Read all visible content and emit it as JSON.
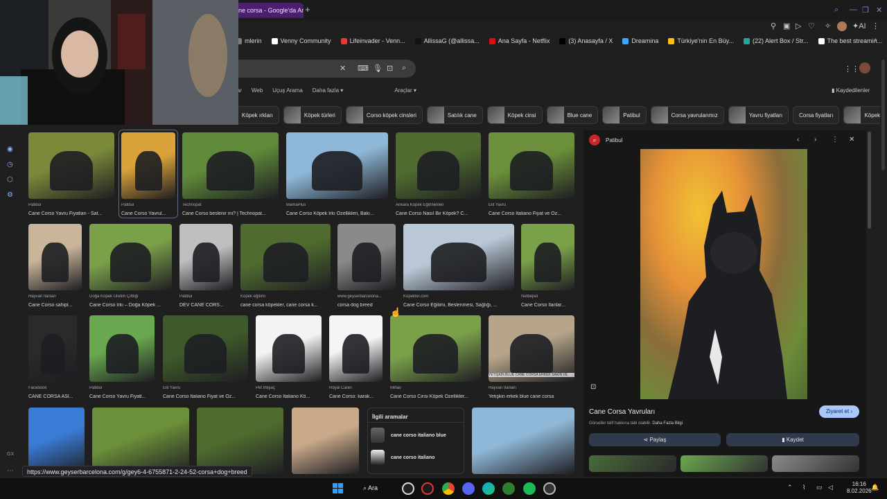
{
  "tab": {
    "title": "ne corsa - Google'da Ar"
  },
  "bookmarks": [
    {
      "label": "mlerin",
      "color": "#7a7a7a"
    },
    {
      "label": "Venny Community",
      "color": "#ffffff"
    },
    {
      "label": "Lifeinvader - Venn...",
      "color": "#e53935"
    },
    {
      "label": "AllissaG (@allissa...",
      "color": "#111111"
    },
    {
      "label": "Ana Sayfa - Netflix",
      "color": "#e50914"
    },
    {
      "label": "(3) Anasayfa / X",
      "color": "#000000"
    },
    {
      "label": "Dreamina",
      "color": "#3ea6ff"
    },
    {
      "label": "Türkiye'nin En Büy...",
      "color": "#ffc107"
    },
    {
      "label": "(22) Alert Box / Str...",
      "color": "#26a69a"
    },
    {
      "label": "The best streamin...",
      "color": "#ffffff"
    }
  ],
  "search": {
    "placeholder": ""
  },
  "nav_tabs": [
    "lar",
    "Web",
    "Uçuş Arama",
    "Daha fazla ▾",
    "Araçlar ▾"
  ],
  "saved_label": "Kaydedilenler",
  "chips": [
    {
      "label": "Köpek ırkları",
      "thumb": false
    },
    {
      "label": "Köpek türleri",
      "thumb": true
    },
    {
      "label": "Corso köpek cinsleri",
      "thumb": true
    },
    {
      "label": "Satılık cane",
      "thumb": true
    },
    {
      "label": "Köpek cinsi",
      "thumb": true
    },
    {
      "label": "Blue cane",
      "thumb": true
    },
    {
      "label": "Patibul",
      "thumb": true
    },
    {
      "label": "Corsa yavrularımız",
      "thumb": true
    },
    {
      "label": "Yavru fiyatları",
      "thumb": true
    },
    {
      "label": "Corsa fiyatları",
      "thumb": false
    },
    {
      "label": "Köpek ırkı",
      "thumb": true
    }
  ],
  "results_row1": [
    {
      "source": "Patibul",
      "caption": "Cane Corso Yavru Fiyatları - Sat..."
    },
    {
      "source": "Patibul",
      "caption": "Cane Corso Yavrul..."
    },
    {
      "source": "Technopat",
      "caption": "Cane Corso beslenir mi? | Technopat..."
    },
    {
      "source": "MamaPlus",
      "caption": "Cane Corso Köpek Irkı Özellikleri, Bakı..."
    },
    {
      "source": "Ankara Köpek Eğitmenleri",
      "caption": "Cane Corso Nasıl Bir Köpek? C..."
    },
    {
      "source": "Elit Yavru",
      "caption": "Cane Corso Italiano Fiyat ve Öz..."
    }
  ],
  "results_row2": [
    {
      "source": "Hayvan İlanları",
      "caption": "Cane Corso sahipl..."
    },
    {
      "source": "Doğa Köpek Üretim Çiftliği",
      "caption": "Cane Corso Irkı – Doğa Köpek ..."
    },
    {
      "source": "Patibul",
      "caption": "DEV CANE CORS..."
    },
    {
      "source": "Köpek eğitimi",
      "caption": "cane corsa köpekler, cane corsa k..."
    },
    {
      "source": "www.geyserbarcelona...",
      "caption": "corsa dog breed"
    },
    {
      "source": "Kopekler.com",
      "caption": "Cane Corso Eğitimi, Beslenmesi, Sağlığı, ..."
    },
    {
      "source": "Netbepet",
      "caption": "Cane Corso İlanlar..."
    }
  ],
  "results_row3": [
    {
      "source": "Facebook",
      "caption": "CANE CORSA ASİ..."
    },
    {
      "source": "Patibul",
      "caption": "Cane Corso Yavru Fiyatl..."
    },
    {
      "source": "Elit Yavru",
      "caption": "Cane Corso Italiano Fiyat ve Öz..."
    },
    {
      "source": "Pet İhtiyaç",
      "caption": "Cane Corso Italiano Kö..."
    },
    {
      "source": "Royal Canin",
      "caption": "Cane Corso: karak..."
    },
    {
      "source": "Mihav",
      "caption": "Cane Corso Cinsi Köpek Özellikler..."
    },
    {
      "source": "Hayvan İlanları",
      "caption": "Yetişkin erkek blue cane corsa"
    }
  ],
  "overlay_text": "YETİŞKİN BLUE CANE CORSA ERKEK SAKİN VE",
  "related": {
    "title": "İlgili aramalar",
    "items": [
      "cane corso italiano blue",
      "cane corso italiano"
    ]
  },
  "panel": {
    "source": "Patibul",
    "title": "Cane Corsa Yavruları",
    "license": "Görseller telif hakkına tabi olabilir.",
    "more": "Daha Fazla Bilgi",
    "visit": "Ziyaret et",
    "share": "Paylaş",
    "save": "Kaydet"
  },
  "status_url": "https://www.geyserbarcelona.com/g/gey6-4-6755871-2-24-52-corsa+dog+breed",
  "taskbar": {
    "search": "Ara",
    "time": "16:16",
    "date": "8.02.2026"
  },
  "colors": {
    "accent": "#a8c7fa",
    "active_tab": "#4a1f6e",
    "background": "#1f1f1f"
  }
}
